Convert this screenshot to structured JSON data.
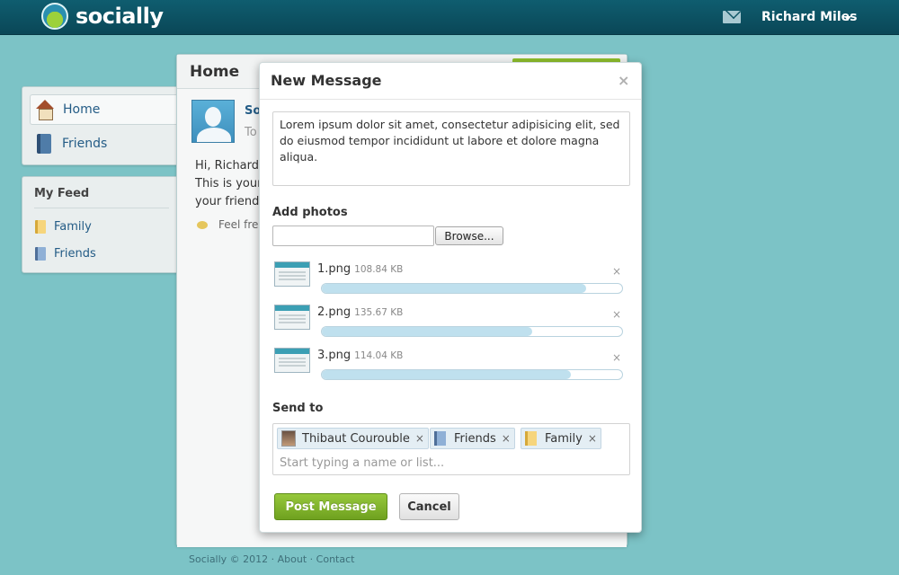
{
  "app": {
    "brand": "socially"
  },
  "header": {
    "user_name": "Richard Miles"
  },
  "sidebar": {
    "nav": [
      {
        "label": "Home",
        "icon": "house-icon",
        "active": true
      },
      {
        "label": "Friends",
        "icon": "book-icon",
        "active": false
      }
    ],
    "feed": {
      "title": "My Feed",
      "items": [
        {
          "label": "Family",
          "icon": "folder-yellow-icon"
        },
        {
          "label": "Friends",
          "icon": "folder-blue-icon"
        }
      ]
    }
  },
  "main": {
    "title": "Home",
    "post": {
      "author": "So",
      "to": "To",
      "lines": [
        "Hi, Richard!",
        "This is your",
        "your friends"
      ],
      "feel": "Feel free"
    }
  },
  "footer": {
    "text": "Socially © 2012 · About · Contact"
  },
  "modal": {
    "title": "New Message",
    "close": "×",
    "message": "Lorem ipsum dolor sit amet, consectetur adipisicing elit, sed do eiusmod tempor incididunt ut labore et dolore magna aliqua.",
    "add_photos_label": "Add photos",
    "browse_label": "Browse...",
    "files": [
      {
        "name": "1.png",
        "size": "108.84 KB",
        "progress": 0.88,
        "remove": "×"
      },
      {
        "name": "2.png",
        "size": "135.67 KB",
        "progress": 0.7,
        "remove": "×"
      },
      {
        "name": "3.png",
        "size": "114.04 KB",
        "progress": 0.83,
        "remove": "×"
      }
    ],
    "send_to_label": "Send to",
    "recipients": [
      {
        "label": "Thibaut Courouble",
        "icon": "token-avatar-icon",
        "remove": "×"
      },
      {
        "label": "Friends",
        "icon": "token-folder-blue-icon",
        "remove": "×"
      },
      {
        "label": "Family",
        "icon": "token-folder-yellow-icon",
        "remove": "×"
      }
    ],
    "recipient_placeholder": "Start typing a name or list...",
    "post_label": "Post Message",
    "cancel_label": "Cancel"
  },
  "colors": {
    "background": "#7cc3c6",
    "topbar": "#0f5d6f",
    "accent_green": "#7fb12b",
    "link": "#245c86"
  }
}
